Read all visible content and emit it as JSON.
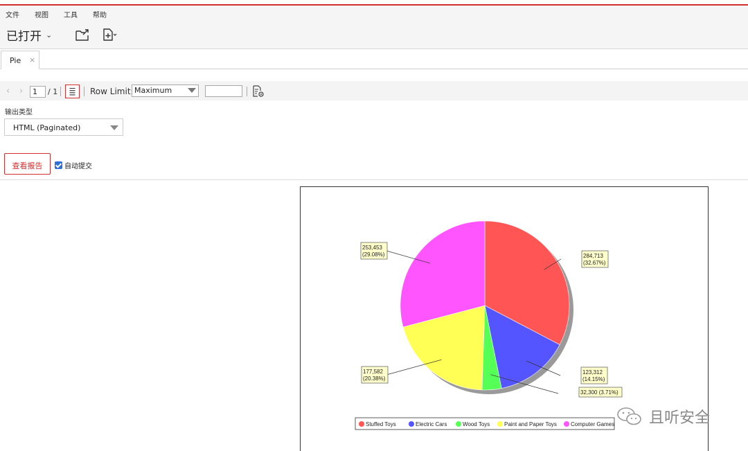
{
  "menu": [
    "文件",
    "视图",
    "工具",
    "帮助"
  ],
  "toolbar": {
    "opened_label": "已打开",
    "open_folder_icon": "folder-open-icon",
    "new_doc_icon": "new-doc-icon"
  },
  "tab": {
    "label": "Pie",
    "close": "×"
  },
  "nav": {
    "page_current": "1",
    "page_total": "/ 1",
    "row_limit_label": "Row Limit:",
    "row_limit_value": "Maximum",
    "row_limit_input": ""
  },
  "output": {
    "label": "输出类型",
    "value": "HTML (Paginated)"
  },
  "actions": {
    "view_report": "查看报告",
    "auto_submit": "自动提交",
    "auto_submit_checked": true
  },
  "watermark": "且听安全",
  "chart_data": {
    "type": "pie",
    "title": "",
    "categories": [
      "Stuffed Toys",
      "Electric Cars",
      "Wood Toys",
      "Paint and Paper Toys",
      "Computer Games"
    ],
    "values": [
      284713,
      123312,
      32300,
      177582,
      253453
    ],
    "value_labels": [
      "284,713",
      "123,312",
      "32,300",
      "177,582",
      "253,453"
    ],
    "percent_labels": [
      "(32.67%)",
      "(14.15%)",
      "(3.71%)",
      "(20.38%)",
      "(29.08%)"
    ],
    "colors": [
      "#ff5555",
      "#5555ff",
      "#55ff55",
      "#ffff55",
      "#ff55ff"
    ],
    "legend": "bottom"
  }
}
